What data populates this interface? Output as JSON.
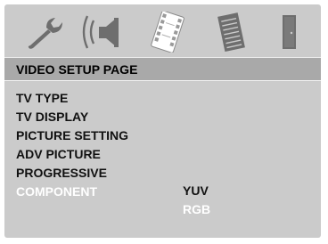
{
  "tabs": [
    {
      "icon": "wrench-icon",
      "selected": false
    },
    {
      "icon": "speaker-icon",
      "selected": false
    },
    {
      "icon": "film-strip-icon",
      "selected": true
    },
    {
      "icon": "document-icon",
      "selected": false
    },
    {
      "icon": "door-icon",
      "selected": false
    }
  ],
  "page": {
    "title": "VIDEO SETUP PAGE"
  },
  "items": [
    {
      "label": "TV TYPE"
    },
    {
      "label": "TV DISPLAY"
    },
    {
      "label": "PICTURE SETTING"
    },
    {
      "label": "ADV PICTURE"
    },
    {
      "label": "PROGRESSIVE"
    },
    {
      "label": "COMPONENT",
      "active": true
    }
  ],
  "options": [
    {
      "label": "YUV"
    },
    {
      "label": "RGB",
      "highlighted": true
    }
  ],
  "colors": {
    "panel": "#cbcbcb",
    "header": "#a9a9a9",
    "icon_gray": "#6e6e6e",
    "selected_icon": "#ffffff",
    "active_text": "#ffffff"
  }
}
